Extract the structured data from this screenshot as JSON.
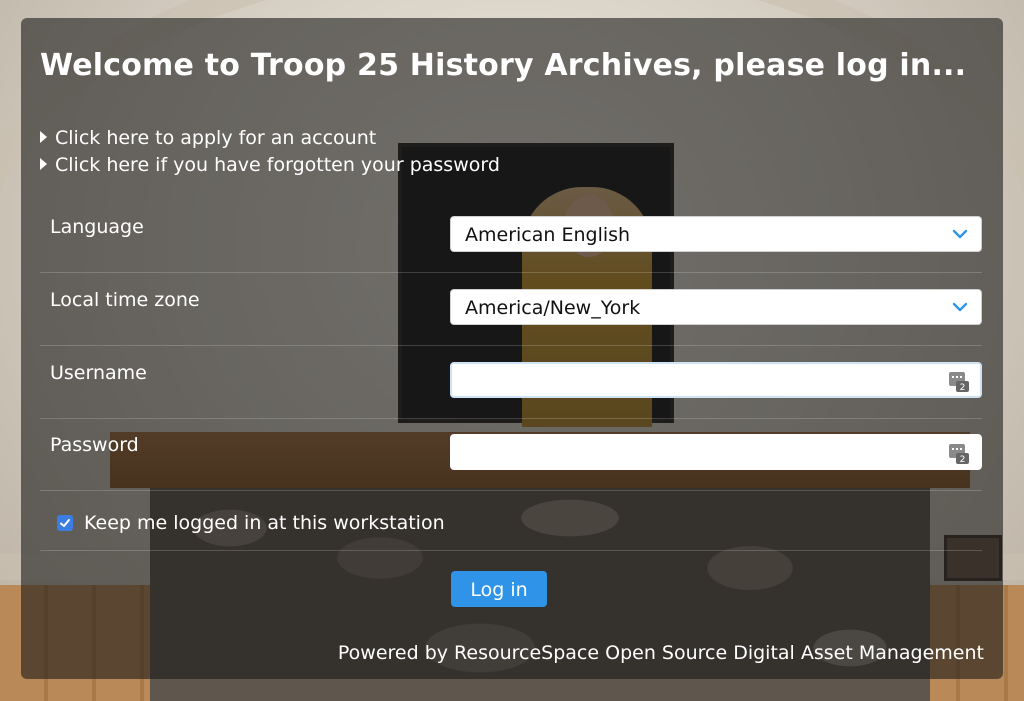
{
  "page": {
    "title": "Welcome to Troop 25 History Archives, please log in...",
    "links": [
      {
        "label": "Click here to apply for an account"
      },
      {
        "label": "Click here if you have forgotten your password"
      }
    ]
  },
  "form": {
    "language": {
      "label": "Language",
      "value": "American English"
    },
    "timezone": {
      "label": "Local time zone",
      "value": "America/New_York"
    },
    "username": {
      "label": "Username",
      "value": "",
      "placeholder": ""
    },
    "password": {
      "label": "Password",
      "value": "",
      "placeholder": ""
    },
    "remember": {
      "label": "Keep me logged in at this workstation",
      "checked": true
    },
    "submit_label": "Log in"
  },
  "footer": {
    "text": "Powered by ResourceSpace Open Source Digital Asset Management"
  },
  "colors": {
    "accent": "#2f94e8",
    "checkbox": "#3b7de0",
    "panel_overlay": "rgba(22,22,22,0.58)"
  },
  "icons": {
    "link_bullet": "triangle-right-icon",
    "select_arrow": "chevron-down-icon",
    "password_manager": "keyboard-autofill-icon"
  }
}
